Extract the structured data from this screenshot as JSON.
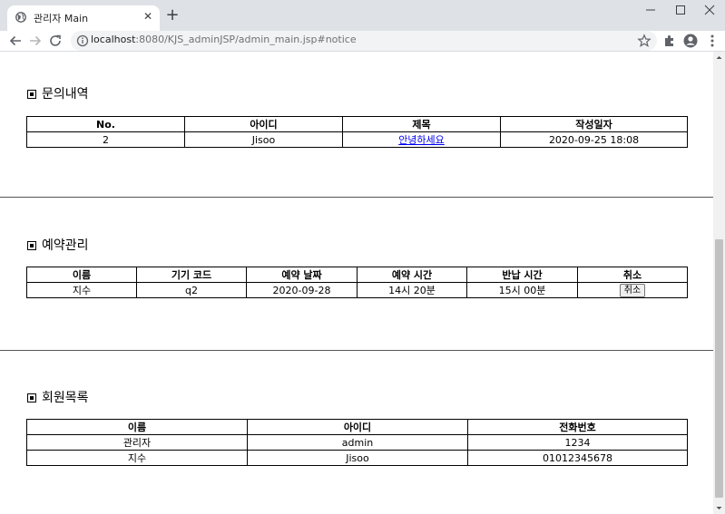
{
  "browser": {
    "tab_title": "관리자 Main",
    "url_host": "localhost",
    "url_path": ":8080/KJS_adminJSP/admin_main.jsp#notice"
  },
  "inquiry": {
    "title": "문의내역",
    "headers": [
      "No.",
      "아이디",
      "제목",
      "작성일자"
    ],
    "rows": [
      {
        "no": "2",
        "id": "Jisoo",
        "subject": "안녕하세요",
        "date": "2020-09-25 18:08"
      }
    ]
  },
  "reservation": {
    "title": "예약관리",
    "headers": [
      "이름",
      "기기 코드",
      "예약 날짜",
      "예약 시간",
      "반납 시간",
      "취소"
    ],
    "rows": [
      {
        "name": "지수",
        "device_code": "q2",
        "date": "2020-09-28",
        "time": "14시 20분",
        "return_time": "15시 00분",
        "cancel_label": "취소"
      }
    ]
  },
  "members": {
    "title": "회원목록",
    "headers": [
      "이름",
      "아이디",
      "전화번호"
    ],
    "rows": [
      {
        "name": "관리자",
        "id": "admin",
        "phone": "1234"
      },
      {
        "name": "지수",
        "id": "Jisoo",
        "phone": "01012345678"
      }
    ]
  }
}
